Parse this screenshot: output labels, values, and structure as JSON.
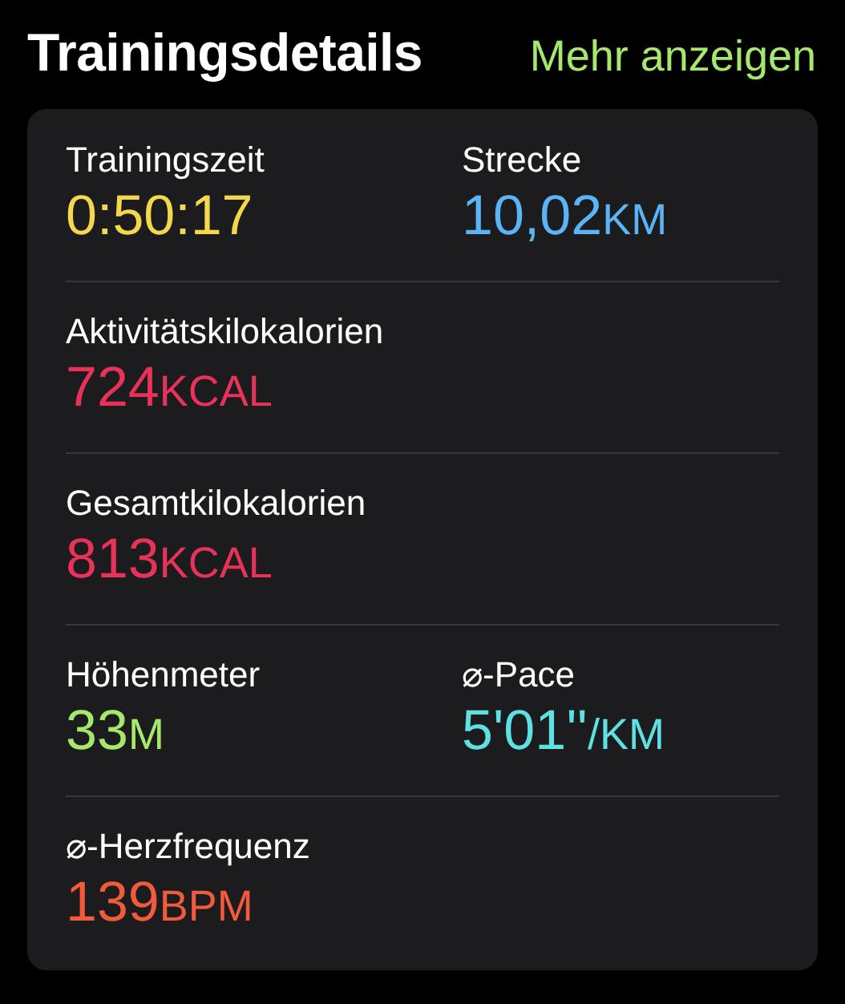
{
  "header": {
    "title": "Trainingsdetails",
    "link": "Mehr anzeigen"
  },
  "rows": [
    {
      "metrics": [
        {
          "label": "Trainingszeit",
          "value": "0:50:17",
          "color": "#f4d74b"
        },
        {
          "label": "Strecke",
          "value": "10,02",
          "unit": "KM",
          "color": "#5ab4f5"
        }
      ]
    },
    {
      "metrics": [
        {
          "label": "Aktivitätskilokalorien",
          "value": "724",
          "unit": "KCAL",
          "color": "#e8325a"
        }
      ]
    },
    {
      "metrics": [
        {
          "label": "Gesamtkilokalorien",
          "value": "813",
          "unit": "KCAL",
          "color": "#e8325a"
        }
      ]
    },
    {
      "metrics": [
        {
          "label": "Höhenmeter",
          "value": "33",
          "unit": "M",
          "color": "#a6e86b"
        },
        {
          "label": "⌀-Pace",
          "value": "5'01''",
          "unit": "/KM",
          "color": "#5fe0e3"
        }
      ]
    },
    {
      "metrics": [
        {
          "label": "⌀-Herzfrequenz",
          "value": "139",
          "unit": "BPM",
          "color": "#ef5b3b"
        }
      ]
    }
  ]
}
